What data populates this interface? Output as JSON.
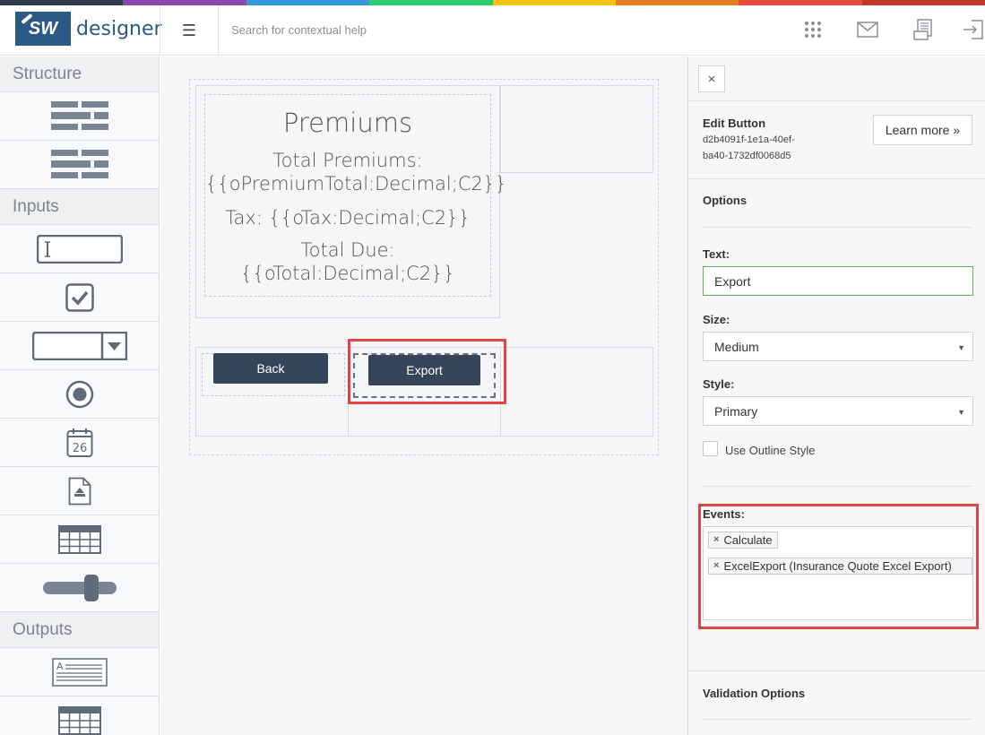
{
  "header": {
    "logo_mark": "SW",
    "logo_text": "designer",
    "menu_icon": "hamburger-icon",
    "search_placeholder": "Search for contextual help",
    "icons": [
      "apps-grid-icon",
      "mail-icon",
      "document-icon",
      "logout-icon"
    ]
  },
  "rainbow_colors": [
    "#2e3a4a",
    "#8e44ad",
    "#3498db",
    "#2ecc71",
    "#f1c40f",
    "#e67e22",
    "#e74c3c",
    "#c0392b"
  ],
  "sidebar": {
    "sections": {
      "structure": "Structure",
      "inputs": "Inputs",
      "outputs": "Outputs"
    },
    "items": {
      "structure": [
        "grid-layout-icon",
        "grid-layout-alt-icon"
      ],
      "inputs": [
        "textbox-icon",
        "checkbox-icon",
        "dropdown-icon",
        "radio-icon",
        "date-picker-icon",
        "file-upload-icon",
        "data-table-icon",
        "slider-icon"
      ],
      "outputs": [
        "text-output-icon",
        "table-output-icon"
      ]
    }
  },
  "canvas": {
    "premiums_title": "Premiums",
    "lines": [
      "Total Premiums:",
      "{{oPremiumTotal:Decimal;C2}}",
      "Tax: {{oTax:Decimal;C2}}",
      "Total Due:",
      "{{oTotal:Decimal;C2}}"
    ],
    "back_label": "Back",
    "export_label": "Export"
  },
  "panel": {
    "close_symbol": "×",
    "title": "Edit Button",
    "id_line1": "d2b4091f-1e1a-40ef-",
    "id_line2": "ba40-1732df0068d5",
    "learn_more": "Learn more »",
    "options_heading": "Options",
    "text_label": "Text:",
    "text_value": "Export",
    "size_label": "Size:",
    "size_value": "Medium",
    "style_label": "Style:",
    "style_value": "Primary",
    "outline_label": "Use Outline Style",
    "events_label": "Events:",
    "events": [
      {
        "x": "×",
        "label": "Calculate"
      },
      {
        "x": "×",
        "label": "ExcelExport (Insurance Quote Excel Export)"
      }
    ],
    "validation_heading": "Validation Options"
  },
  "colors": {
    "brand": "#2b5b84",
    "button_dark": "#34455a",
    "highlight_red": "#e04444",
    "active_field": "#5cb85c"
  }
}
